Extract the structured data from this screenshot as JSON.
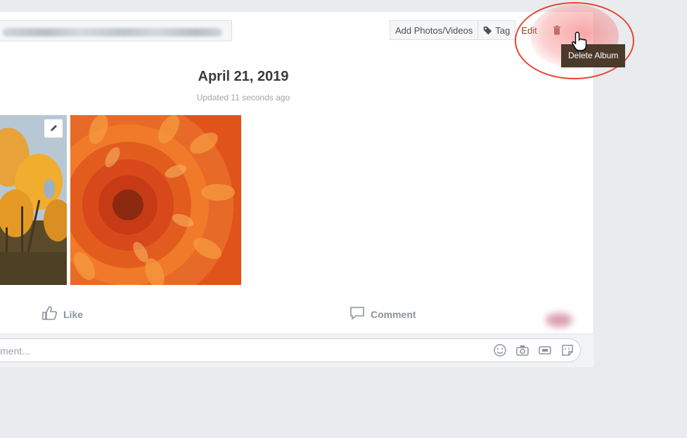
{
  "toolbar": {
    "add_label": "Add Photos/Videos",
    "tag_label": "Tag",
    "edit_label": "Edit"
  },
  "tooltip": {
    "label": "Delete Album"
  },
  "album": {
    "title": "April 21, 2019",
    "updated": "Updated 11 seconds ago"
  },
  "actions": {
    "like_label": "Like",
    "comment_label": "Comment"
  },
  "comment_box": {
    "placeholder": "ment..."
  },
  "colors": {
    "highlight": "#e8452c",
    "tooltip_bg": "#4b3a2a",
    "edit_text": "#8a3a1a"
  }
}
